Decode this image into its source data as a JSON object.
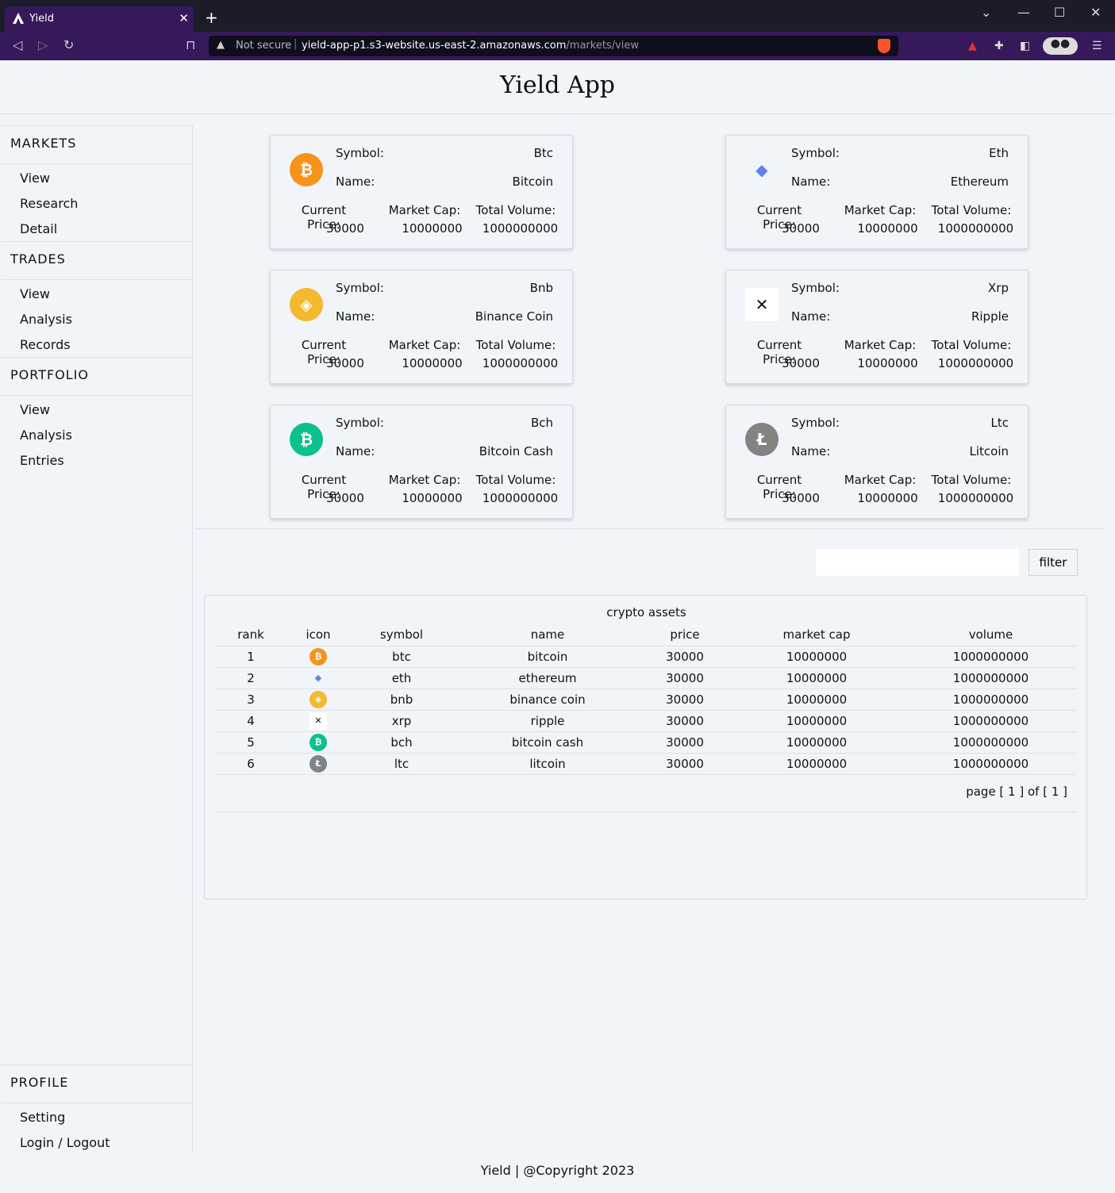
{
  "browser": {
    "tab_title": "Yield",
    "url_warning": "Not secure",
    "url_host": "yield-app-p1.s3-website.us-east-2.amazonaws.com",
    "url_path": "/markets/view"
  },
  "header": {
    "title": "Yield App"
  },
  "sidebar": {
    "sections": [
      {
        "title": "MARKETS",
        "items": [
          "View",
          "Research",
          "Detail"
        ]
      },
      {
        "title": "TRADES",
        "items": [
          "View",
          "Analysis",
          "Records"
        ]
      },
      {
        "title": "PORTFOLIO",
        "items": [
          "View",
          "Analysis",
          "Entries"
        ]
      }
    ],
    "profile": {
      "title": "PROFILE",
      "items": [
        "Setting",
        "Login / Logout"
      ]
    }
  },
  "cards_labels": {
    "symbol": "Symbol:",
    "name": "Name:",
    "price": "Current Price:",
    "cap": "Market Cap:",
    "volume": "Total Volume:"
  },
  "cards": [
    {
      "symbol": "Btc",
      "name": "Bitcoin",
      "price": "30000",
      "cap": "10000000",
      "volume": "1000000000",
      "icon": "bitcoin-icon",
      "color": "#f7931a",
      "glyph": "₿"
    },
    {
      "symbol": "Eth",
      "name": "Ethereum",
      "price": "30000",
      "cap": "10000000",
      "volume": "1000000000",
      "icon": "ethereum-icon",
      "color": "#627eea",
      "glyph": "◆"
    },
    {
      "symbol": "Bnb",
      "name": "Binance Coin",
      "price": "30000",
      "cap": "10000000",
      "volume": "1000000000",
      "icon": "binance-icon",
      "color": "#f3ba2f",
      "glyph": "◈"
    },
    {
      "symbol": "Xrp",
      "name": "Ripple",
      "price": "30000",
      "cap": "10000000",
      "volume": "1000000000",
      "icon": "ripple-icon",
      "color": "#ffffff",
      "glyph": "✕"
    },
    {
      "symbol": "Bch",
      "name": "Bitcoin Cash",
      "price": "30000",
      "cap": "10000000",
      "volume": "1000000000",
      "icon": "bitcoin-cash-icon",
      "color": "#0ac18e",
      "glyph": "₿"
    },
    {
      "symbol": "Ltc",
      "name": "Litcoin",
      "price": "30000",
      "cap": "10000000",
      "volume": "1000000000",
      "icon": "litecoin-icon",
      "color": "#838383",
      "glyph": "Ł"
    }
  ],
  "filter": {
    "button_label": "filter",
    "value": ""
  },
  "table": {
    "caption": "crypto assets",
    "headers": [
      "rank",
      "icon",
      "symbol",
      "name",
      "price",
      "market cap",
      "volume"
    ],
    "rows": [
      {
        "rank": "1",
        "symbol": "btc",
        "name": "bitcoin",
        "price": "30000",
        "cap": "10000000",
        "volume": "1000000000"
      },
      {
        "rank": "2",
        "symbol": "eth",
        "name": "ethereum",
        "price": "30000",
        "cap": "10000000",
        "volume": "1000000000"
      },
      {
        "rank": "3",
        "symbol": "bnb",
        "name": "binance coin",
        "price": "30000",
        "cap": "10000000",
        "volume": "1000000000"
      },
      {
        "rank": "4",
        "symbol": "xrp",
        "name": "ripple",
        "price": "30000",
        "cap": "10000000",
        "volume": "1000000000"
      },
      {
        "rank": "5",
        "symbol": "bch",
        "name": "bitcoin cash",
        "price": "30000",
        "cap": "10000000",
        "volume": "1000000000"
      },
      {
        "rank": "6",
        "symbol": "ltc",
        "name": "litcoin",
        "price": "30000",
        "cap": "10000000",
        "volume": "1000000000"
      }
    ],
    "pagination": "page [ 1 ] of [ 1 ]"
  },
  "footer": {
    "text": "Yield | @Copyright 2023"
  }
}
